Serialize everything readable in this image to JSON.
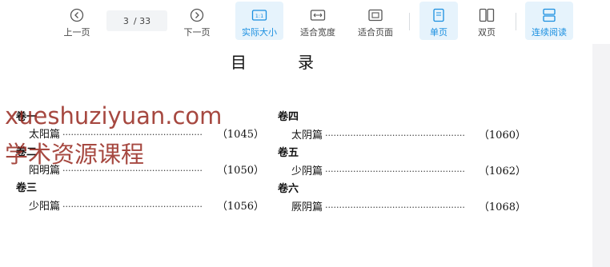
{
  "toolbar": {
    "prev_label": "上一页",
    "next_label": "下一页",
    "current_page": "3",
    "total_pages": "/ 33",
    "actual_size_label": "实际大小",
    "fit_width_label": "适合宽度",
    "fit_page_label": "适合页面",
    "single_page_label": "单页",
    "double_page_label": "双页",
    "continuous_label": "连续阅读",
    "accent_color": "#1a8fe0"
  },
  "document": {
    "title_left": "目",
    "title_right": "录",
    "columns": [
      {
        "volumes": [
          {
            "label": "卷一",
            "entry": "太阳篇",
            "page": "（1045）"
          },
          {
            "label": "卷二",
            "entry": "阳明篇",
            "page": "（1050）"
          },
          {
            "label": "卷三",
            "entry": "少阳篇",
            "page": "（1056）"
          }
        ]
      },
      {
        "volumes": [
          {
            "label": "卷四",
            "entry": "太阴篇",
            "page": "（1060）"
          },
          {
            "label": "卷五",
            "entry": "少阴篇",
            "page": "（1062）"
          },
          {
            "label": "卷六",
            "entry": "厥阴篇",
            "page": "（1068）"
          }
        ]
      }
    ]
  },
  "watermark": {
    "line1": "xueshuziyuan.com",
    "line2": "学术资源课程"
  }
}
